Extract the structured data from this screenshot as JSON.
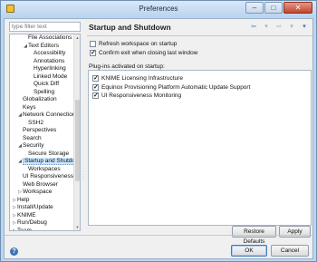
{
  "window": {
    "title": "Preferences"
  },
  "filter": {
    "placeholder": "type filter text"
  },
  "tree": {
    "items": [
      {
        "label": "File Associations",
        "indent": 3,
        "toggle": ""
      },
      {
        "label": "Text Editors",
        "indent": 3,
        "toggle": "◢"
      },
      {
        "label": "Accessibility",
        "indent": 4,
        "toggle": ""
      },
      {
        "label": "Annotations",
        "indent": 4,
        "toggle": ""
      },
      {
        "label": "Hyperlinking",
        "indent": 4,
        "toggle": ""
      },
      {
        "label": "Linked Mode",
        "indent": 4,
        "toggle": ""
      },
      {
        "label": "Quick Diff",
        "indent": 4,
        "toggle": ""
      },
      {
        "label": "Spelling",
        "indent": 4,
        "toggle": ""
      },
      {
        "label": "Globalization",
        "indent": 2,
        "toggle": ""
      },
      {
        "label": "Keys",
        "indent": 2,
        "toggle": ""
      },
      {
        "label": "Network Connections",
        "indent": 2,
        "toggle": "◢"
      },
      {
        "label": "SSH2",
        "indent": 3,
        "toggle": ""
      },
      {
        "label": "Perspectives",
        "indent": 2,
        "toggle": ""
      },
      {
        "label": "Search",
        "indent": 2,
        "toggle": ""
      },
      {
        "label": "Security",
        "indent": 2,
        "toggle": "◢"
      },
      {
        "label": "Secure Storage",
        "indent": 3,
        "toggle": ""
      },
      {
        "label": "Startup and Shutdown",
        "indent": 2,
        "toggle": "◢",
        "selected": true
      },
      {
        "label": "Workspaces",
        "indent": 3,
        "toggle": ""
      },
      {
        "label": "UI Responsiveness Monitoring",
        "indent": 2,
        "toggle": ""
      },
      {
        "label": "Web Browser",
        "indent": 2,
        "toggle": ""
      },
      {
        "label": "Workspace",
        "indent": 2,
        "toggle": "▷"
      },
      {
        "label": "Help",
        "indent": 1,
        "toggle": "▷"
      },
      {
        "label": "Install/Update",
        "indent": 1,
        "toggle": "▷"
      },
      {
        "label": "KNIME",
        "indent": 1,
        "toggle": "▷"
      },
      {
        "label": "Run/Debug",
        "indent": 1,
        "toggle": "▷"
      },
      {
        "label": "Team",
        "indent": 1,
        "toggle": "▷"
      }
    ]
  },
  "page": {
    "title": "Startup and Shutdown",
    "nav": {
      "back": "⇦",
      "back_menu": "▾",
      "forward": "⇨",
      "forward_menu": "▾",
      "menu": "▾"
    },
    "refresh_label": "Refresh workspace on startup",
    "refresh_checked": false,
    "confirm_label": "Confirm exit when closing last window",
    "confirm_checked": true,
    "plugins_label": "Plug-ins activated on startup:",
    "plugins": [
      {
        "label": "KNIME Licensing Infrastructure",
        "checked": true
      },
      {
        "label": "Equinox Provisioning Platform Automatic Update Support",
        "checked": true
      },
      {
        "label": "UI Responsiveness Monitoring",
        "checked": true
      }
    ],
    "restore_label": "Restore Defaults",
    "apply_label": "Apply"
  },
  "footer": {
    "ok_label": "OK",
    "cancel_label": "Cancel",
    "help_glyph": "?"
  },
  "icons": {
    "app": "preferences-app-icon",
    "help": "help-icon"
  }
}
